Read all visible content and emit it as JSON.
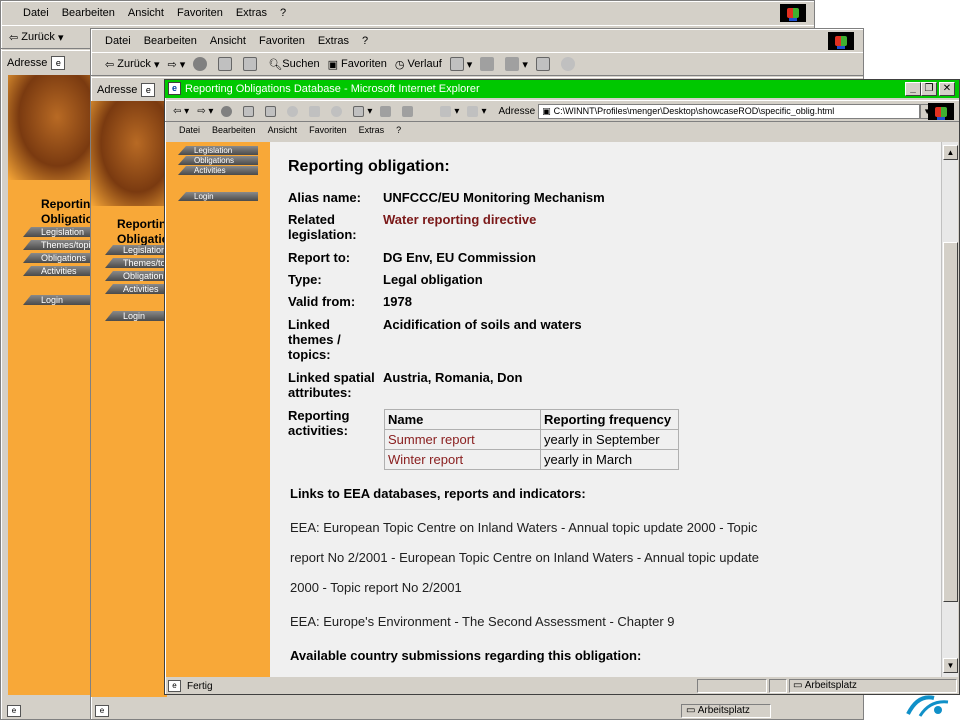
{
  "menu": [
    "Datei",
    "Bearbeiten",
    "Ansicht",
    "Favoriten",
    "Extras",
    "?"
  ],
  "toolbar": {
    "back": "Zurück",
    "search": "Suchen",
    "favorites": "Favoriten",
    "history": "Verlauf"
  },
  "addr_label": "Adresse",
  "sidebar": {
    "title_1": "Reporting",
    "title_2": "Obligations",
    "items": [
      "Legislation",
      "Themes/topics",
      "Obligations",
      "Activities"
    ],
    "login": "Login"
  },
  "front": {
    "title": "Reporting Obligations Database - Microsoft Internet Explorer",
    "address_label": "Adresse",
    "address": "C:\\WINNT\\Profiles\\menger\\Desktop\\showcaseROD\\specific_oblig.html",
    "menu": [
      "Datei",
      "Bearbeiten",
      "Ansicht",
      "Favoriten",
      "Extras",
      "?"
    ],
    "status_left": "Fertig",
    "status_right": "Arbeitsplatz"
  },
  "page": {
    "heading": "Reporting obligation:",
    "fields": [
      {
        "label": "Alias name:",
        "value": "UNFCCC/EU Monitoring Mechanism",
        "link": false
      },
      {
        "label": "Related legislation:",
        "value": "Water reporting directive",
        "link": true
      },
      {
        "label": "Report to:",
        "value": "DG Env, EU Commission",
        "link": false
      },
      {
        "label": "Type:",
        "value": "Legal obligation",
        "link": false
      },
      {
        "label": "Valid from:",
        "value": "1978",
        "link": false
      },
      {
        "label": "Linked themes / topics:",
        "value": "Acidification of soils and waters",
        "link": false
      },
      {
        "label": "Linked spatial attributes:",
        "value": "Austria, Romania, Don",
        "link": false
      }
    ],
    "activities_label": "Reporting activities:",
    "activities_headers": [
      "Name",
      "Reporting frequency"
    ],
    "activities": [
      {
        "name": "Summer report",
        "frequency": "yearly in September"
      },
      {
        "name": "Winter report",
        "frequency": "yearly in March"
      }
    ],
    "links_heading": "Links to EEA databases, reports and indicators:",
    "links_text_1": "EEA: European Topic Centre on Inland Waters - Annual topic update 2000 - Topic",
    "links_text_2": "report No 2/2001 - European Topic Centre on Inland Waters - Annual topic update",
    "links_text_3": "2000 - Topic report No 2/2001",
    "links_text_4": "EEA: Europe's Environment - The Second Assessment - Chapter 9",
    "submissions_heading": "Available country submissions regarding this obligation:"
  },
  "taskbar": {
    "status_right": "Arbeitsplatz"
  }
}
